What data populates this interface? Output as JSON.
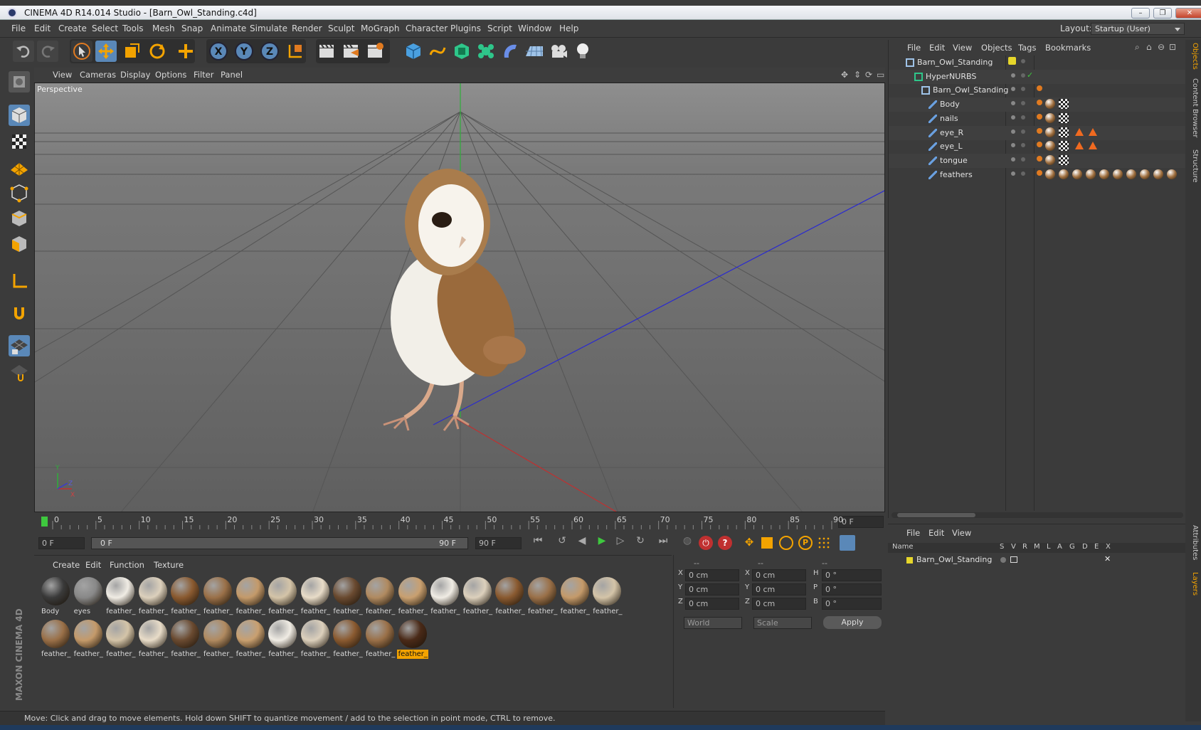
{
  "window": {
    "title": "CINEMA 4D R14.014 Studio - [Barn_Owl_Standing.c4d]",
    "buttons": [
      "–",
      "❐",
      "✕"
    ]
  },
  "menu": {
    "items": [
      "File",
      "Edit",
      "Create",
      "Select",
      "Tools",
      "Mesh",
      "Snap",
      "Animate",
      "Simulate",
      "Render",
      "Sculpt",
      "MoGraph",
      "Character",
      "Plugins",
      "Script",
      "Window",
      "Help"
    ],
    "layout_label": "Layout:",
    "layout_value": "Startup (User)"
  },
  "viewport": {
    "menu": [
      "View",
      "Cameras",
      "Display",
      "Options",
      "Filter",
      "Panel"
    ],
    "label": "Perspective",
    "axis": {
      "y": "Y",
      "x": "X",
      "z": "Z"
    }
  },
  "timeline": {
    "ticks": [
      "0",
      "5",
      "10",
      "15",
      "20",
      "25",
      "30",
      "35",
      "40",
      "45",
      "50",
      "55",
      "60",
      "65",
      "70",
      "75",
      "80",
      "85",
      "90"
    ],
    "current": "0 F",
    "start": "0 F",
    "range_start": "0 F",
    "range_end": "90 F",
    "end": "90 F"
  },
  "materials": {
    "menu": [
      "Create",
      "Edit",
      "Function",
      "Texture"
    ],
    "row1": [
      "Body",
      "eyes",
      "feather_",
      "feather_",
      "feather_",
      "feather_",
      "feather_",
      "feather_",
      "feather_",
      "feather_",
      "feather_",
      "feather_",
      "feather_",
      "feather_",
      "feather_",
      "feather_",
      "feather_",
      "feather_"
    ],
    "row2": [
      "feather_",
      "feather_",
      "feather_",
      "feather_",
      "feather_",
      "feather_",
      "feather_",
      "feather_",
      "feather_",
      "feather_",
      "feather_",
      "feather_"
    ]
  },
  "coords": {
    "headers": [
      "--",
      "--",
      "--"
    ],
    "rows": [
      {
        "a": "X",
        "av": "0 cm",
        "b": "X",
        "bv": "0 cm",
        "c": "H",
        "cv": "0 °"
      },
      {
        "a": "Y",
        "av": "0 cm",
        "b": "Y",
        "bv": "0 cm",
        "c": "P",
        "cv": "0 °"
      },
      {
        "a": "Z",
        "av": "0 cm",
        "b": "Z",
        "bv": "0 cm",
        "c": "B",
        "cv": "0 °"
      }
    ],
    "space": "World",
    "mode": "Scale",
    "apply": "Apply"
  },
  "objects": {
    "menu": [
      "File",
      "Edit",
      "View",
      "Objects",
      "Tags",
      "Bookmarks"
    ],
    "tree": [
      {
        "name": "Barn_Owl_Standing",
        "indent": 0
      },
      {
        "name": "HyperNURBS",
        "indent": 1
      },
      {
        "name": "Barn_Owl_Standing",
        "indent": 2
      },
      {
        "name": "Body",
        "indent": 3
      },
      {
        "name": "nails",
        "indent": 3
      },
      {
        "name": "eye_R",
        "indent": 3
      },
      {
        "name": "eye_L",
        "indent": 3
      },
      {
        "name": "tongue",
        "indent": 3
      },
      {
        "name": "feathers",
        "indent": 3
      }
    ]
  },
  "layers": {
    "menu": [
      "File",
      "Edit",
      "View"
    ],
    "columns": [
      "Name",
      "S",
      "V",
      "R",
      "M",
      "L",
      "A",
      "G",
      "D",
      "E",
      "X"
    ],
    "row": "Barn_Owl_Standing"
  },
  "side_tabs": [
    "Objects",
    "Content Browser",
    "Structure",
    "Attributes",
    "Layers"
  ],
  "brand": "MAXON CINEMA 4D",
  "status": "Move: Click and drag to move elements. Hold down SHIFT to quantize movement / add to the selection in point mode, CTRL to remove.",
  "colors": {
    "accent": "#f3a300",
    "selected_tool": "#5a88b8",
    "panel": "#3b3b3b"
  }
}
